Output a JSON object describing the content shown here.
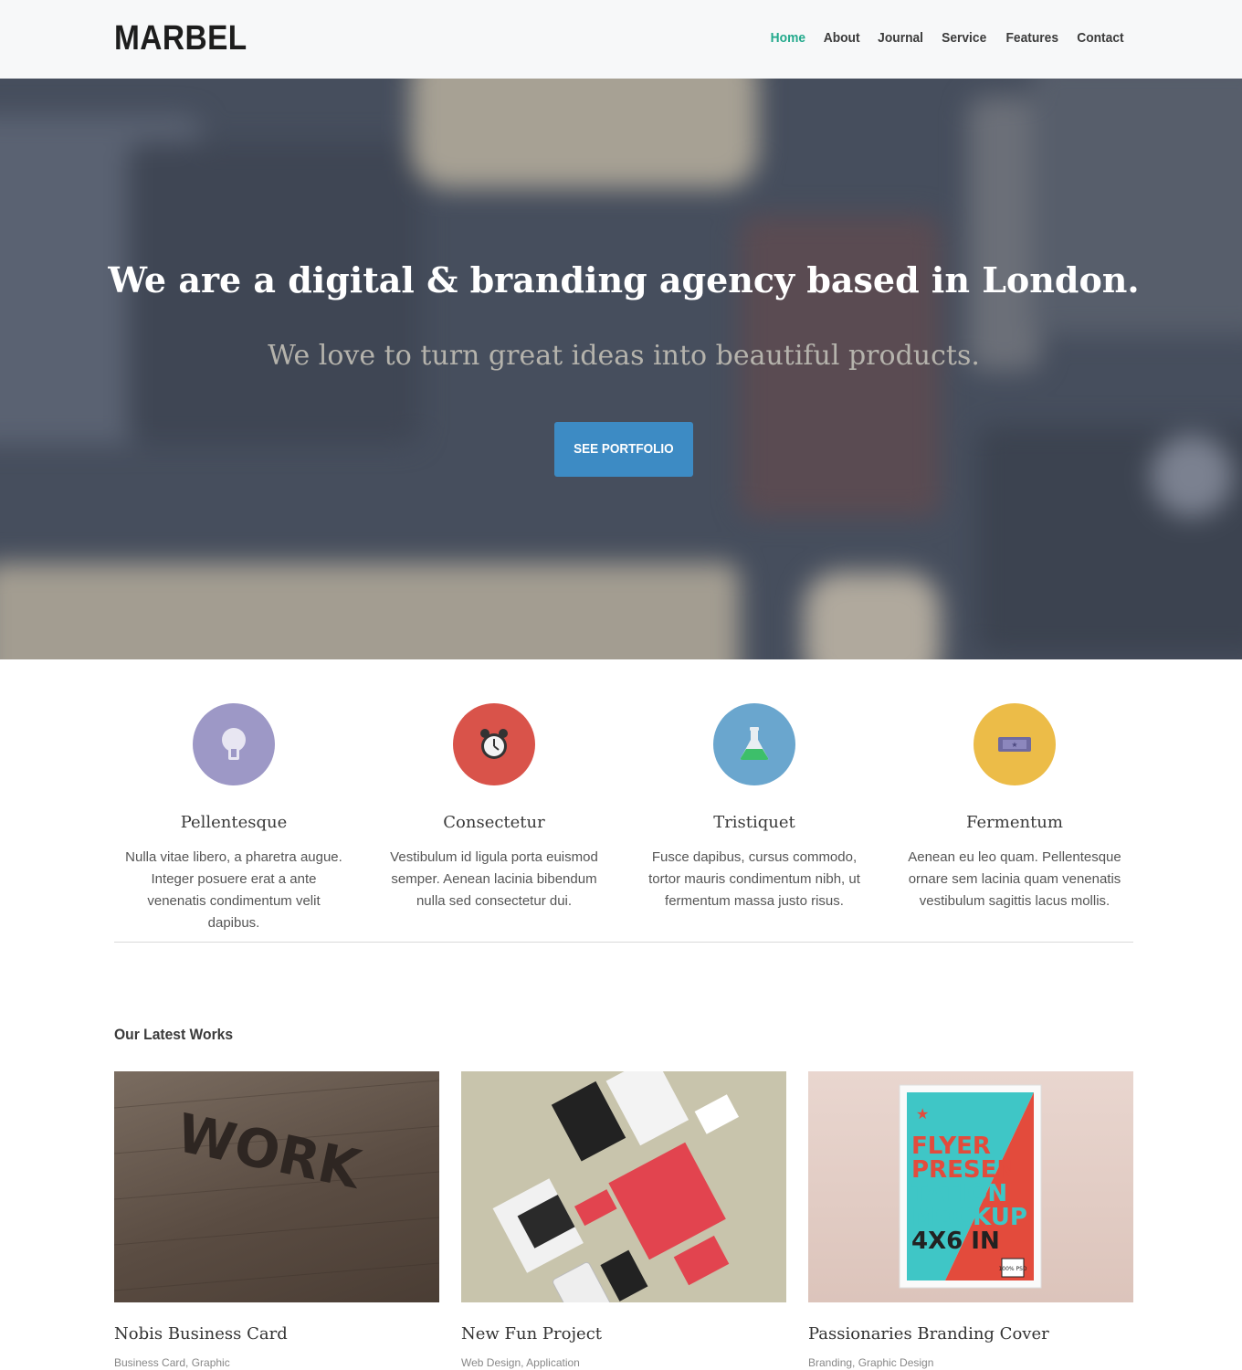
{
  "brand": {
    "logo": "MARBEL"
  },
  "nav": {
    "items": [
      {
        "label": "Home",
        "active": true
      },
      {
        "label": "About"
      },
      {
        "label": "Journal"
      },
      {
        "label": "Service"
      },
      {
        "label": "Features"
      },
      {
        "label": "Contact"
      }
    ]
  },
  "hero": {
    "title": "We are a digital & branding agency based in London.",
    "subtitle": "We love to turn great ideas into beautiful products.",
    "button_label": "SEE PORTFOLIO"
  },
  "features": [
    {
      "icon": "lightbulb-icon",
      "color": "#9d98c6",
      "title": "Pellentesque",
      "text": "Nulla vitae libero, a pharetra augue. Integer posuere erat a ante venenatis condimentum velit dapibus."
    },
    {
      "icon": "alarm-clock-icon",
      "color": "#d9534a",
      "title": "Consectetur",
      "text": "Vestibulum id ligula porta euismod semper. Aenean lacinia bibendum nulla sed consectetur dui."
    },
    {
      "icon": "flask-icon",
      "color": "#6aa6ce",
      "title": "Tristiquet",
      "text": "Fusce dapibus, cursus commodo, tortor mauris condimentum nibh, ut fermentum massa justo risus."
    },
    {
      "icon": "ticket-icon",
      "color": "#ecbc48",
      "title": "Fermentum",
      "text": "Aenean eu leo quam. Pellentesque ornare sem lacinia quam venenatis vestibulum sagittis lacus mollis."
    }
  ],
  "works": {
    "heading": "Our Latest Works",
    "items": [
      {
        "title": "Nobis Business Card",
        "categories": "Business Card, Graphic"
      },
      {
        "title": "New Fun Project",
        "categories": "Web Design, Application"
      },
      {
        "title": "Passionaries Branding Cover",
        "categories": "Branding, Graphic Design"
      }
    ]
  },
  "images": {
    "wood_letters": "WORK",
    "poster_lines": [
      "FLYER",
      "PRESEN",
      "TATION",
      "MOCKUP",
      "4X6 IN"
    ],
    "poster_badge": "100% PSD"
  }
}
